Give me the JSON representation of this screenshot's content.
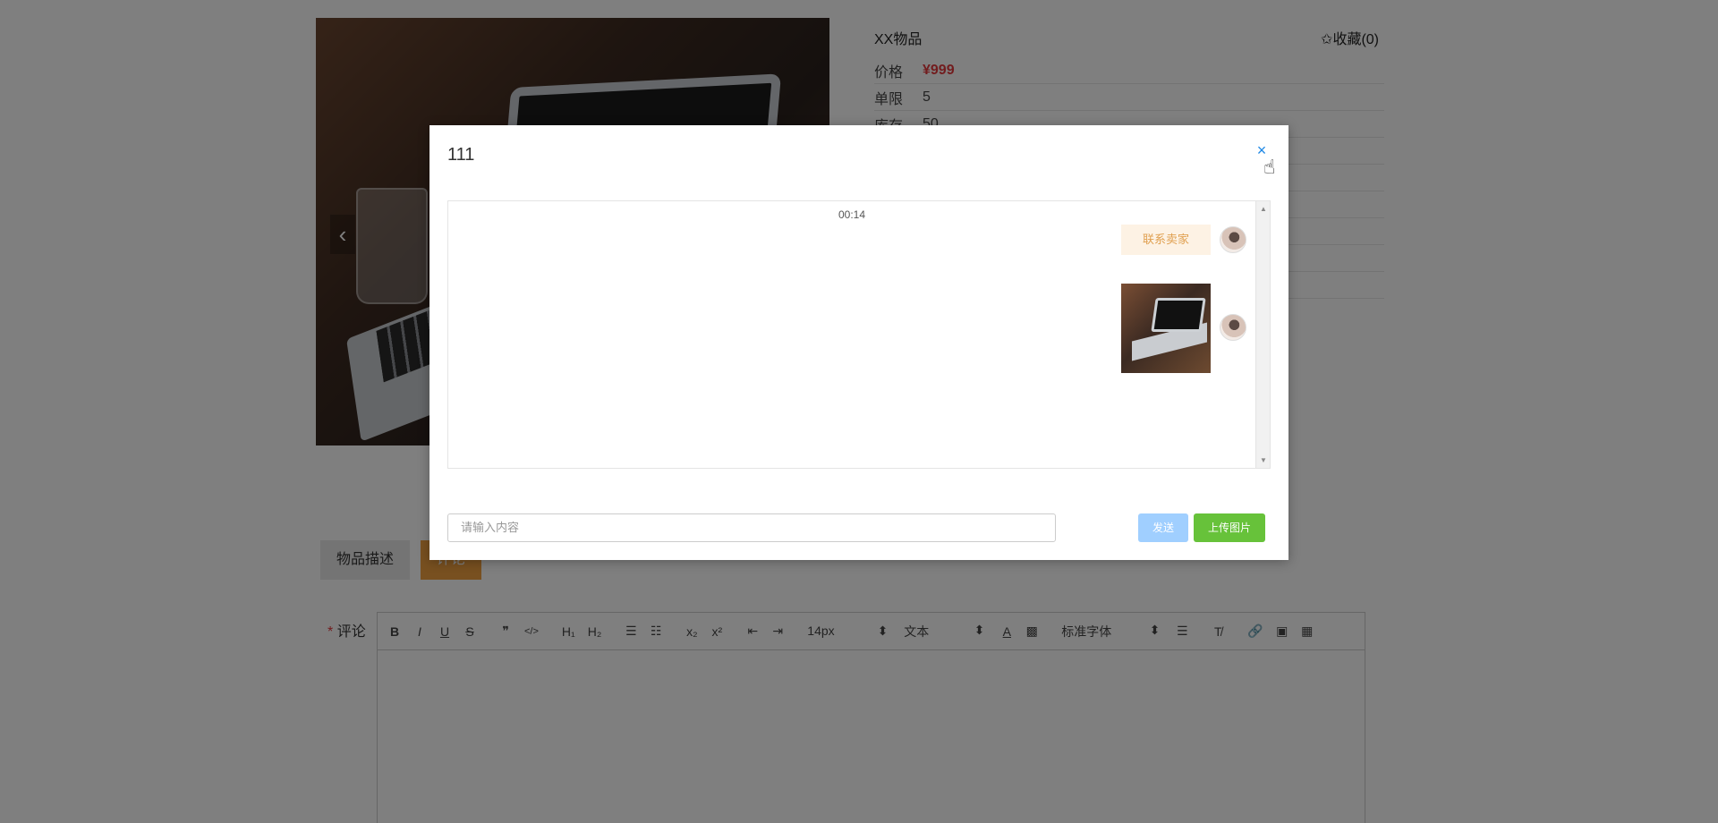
{
  "product": {
    "title": "XX物品",
    "favorite": "✩收藏(0)",
    "fields": [
      {
        "key": "价格",
        "value": "¥999"
      },
      {
        "key": "单限",
        "value": "5"
      },
      {
        "key": "库存",
        "value": "50"
      }
    ],
    "prev_arrow": "‹"
  },
  "tabs": [
    {
      "label": "物品描述",
      "active": false
    },
    {
      "label": "评论",
      "active": true
    }
  ],
  "comment": {
    "label": "评论",
    "required_mark": "*"
  },
  "editor_toolbar": {
    "bold": "B",
    "italic": "I",
    "underline": "U",
    "strike": "S",
    "quote": "❞",
    "code": "</>",
    "h1": "H₁",
    "h2": "H₂",
    "ordered_list": "☰",
    "bullet_list": "☷",
    "subscript": "x₂",
    "superscript": "x²",
    "outdent": "⇤",
    "indent": "⇥",
    "font_size": "14px",
    "paragraph": "文本",
    "text_color": "A",
    "bg_color": "▩",
    "font_family": "标准字体",
    "align": "☰",
    "clear": "T̸",
    "link": "🔗",
    "image": "▣",
    "video": "▦",
    "select_caret": "⬍"
  },
  "modal": {
    "title": "111",
    "close": "×",
    "chat": {
      "time": "00:14",
      "text_message": "联系卖家",
      "scroll_up": "▲",
      "scroll_down": "▼"
    },
    "input": {
      "placeholder": "请输入内容"
    },
    "send_button": "发送",
    "upload_button": "上传图片"
  },
  "cursor": "☝"
}
